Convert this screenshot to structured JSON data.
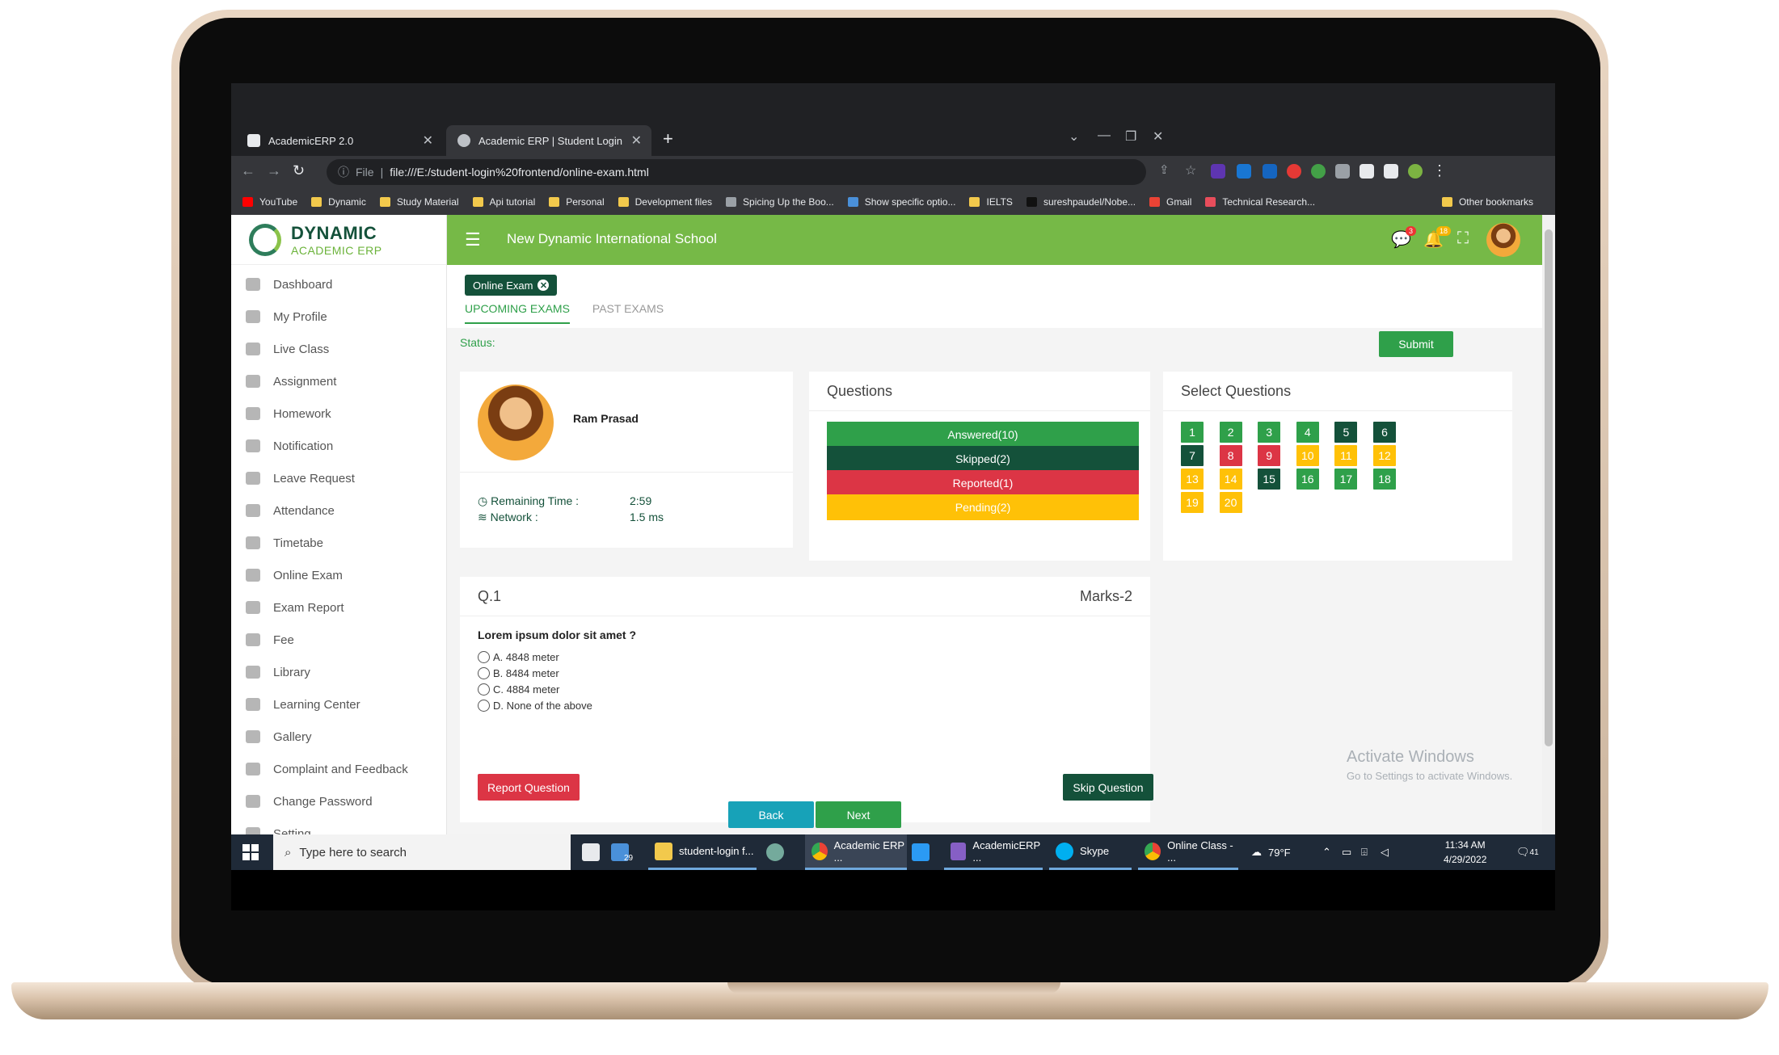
{
  "browser": {
    "tabs": [
      {
        "label": "AcademicERP 2.0"
      },
      {
        "label": "Academic ERP | Student Login"
      }
    ],
    "url_prefix": "File",
    "url": "file:///E:/student-login%20frontend/online-exam.html",
    "bookmarks": [
      {
        "label": "YouTube",
        "color": "#ff0000"
      },
      {
        "label": "Dynamic",
        "color": "#f2c94c"
      },
      {
        "label": "Study Material",
        "color": "#f2c94c"
      },
      {
        "label": "Api tutorial",
        "color": "#f2c94c"
      },
      {
        "label": "Personal",
        "color": "#f2c94c"
      },
      {
        "label": "Development files",
        "color": "#f2c94c"
      },
      {
        "label": "Spicing Up the Boo...",
        "color": "#9aa0a6"
      },
      {
        "label": "Show specific optio...",
        "color": "#4a90d9"
      },
      {
        "label": "IELTS",
        "color": "#f2c94c"
      },
      {
        "label": "sureshpaudel/Nobe...",
        "color": "#111111"
      },
      {
        "label": "Gmail",
        "color": "#ea4335"
      },
      {
        "label": "Technical Research...",
        "color": "#e84d5b"
      }
    ],
    "other_bookmarks": "Other bookmarks"
  },
  "app": {
    "logo_title": "DYNAMIC",
    "logo_sub": "ACADEMIC ERP",
    "school": "New Dynamic International School",
    "notif_badge_1": "3",
    "notif_badge_2": "18",
    "menu": [
      "Dashboard",
      "My Profile",
      "Live Class",
      "Assignment",
      "Homework",
      "Notification",
      "Leave Request",
      "Attendance",
      "Timetabe",
      "Online Exam",
      "Exam Report",
      "Fee",
      "Library",
      "Learning Center",
      "Gallery",
      "Complaint and Feedback",
      "Change Password",
      "Setting"
    ],
    "chip": "Online Exam",
    "tabs": [
      "UPCOMING EXAMS",
      "PAST EXAMS"
    ],
    "status_label": "Status:",
    "submit_label": "Submit"
  },
  "profile": {
    "name": "Ram Prasad",
    "remaining_label": "Remaining Time :",
    "remaining_value": "2:59",
    "network_label": "Network :",
    "network_value": "1.5 ms"
  },
  "questions_card": {
    "title": "Questions",
    "answered": "Answered(10)",
    "skipped": "Skipped(2)",
    "reported": "Reported(1)",
    "pending": "Pending(2)"
  },
  "select_card": {
    "title": "Select Questions",
    "numbers": [
      {
        "n": "1",
        "state": "answered"
      },
      {
        "n": "2",
        "state": "answered"
      },
      {
        "n": "3",
        "state": "answered"
      },
      {
        "n": "4",
        "state": "answered"
      },
      {
        "n": "5",
        "state": "skipped"
      },
      {
        "n": "6",
        "state": "skipped"
      },
      {
        "n": "7",
        "state": "skipped"
      },
      {
        "n": "8",
        "state": "reported"
      },
      {
        "n": "9",
        "state": "reported"
      },
      {
        "n": "10",
        "state": "pending"
      },
      {
        "n": "11",
        "state": "pending"
      },
      {
        "n": "12",
        "state": "pending"
      },
      {
        "n": "13",
        "state": "pending"
      },
      {
        "n": "14",
        "state": "pending"
      },
      {
        "n": "15",
        "state": "skipped"
      },
      {
        "n": "16",
        "state": "answered"
      },
      {
        "n": "17",
        "state": "answered"
      },
      {
        "n": "18",
        "state": "answered"
      },
      {
        "n": "19",
        "state": "pending"
      },
      {
        "n": "20",
        "state": "pending"
      }
    ]
  },
  "question": {
    "number": "Q.1",
    "marks": "Marks-2",
    "text": "Lorem ipsum dolor sit amet ?",
    "options": [
      "A. 4848 meter",
      "B. 8484 meter",
      "C. 4884 meter",
      "D. None of the above"
    ],
    "report_label": "Report Question",
    "skip_label": "Skip Question",
    "back_label": "Back",
    "next_label": "Next"
  },
  "watermark": {
    "line1": "Activate Windows",
    "line2": "Go to Settings to activate Windows."
  },
  "taskbar": {
    "search_placeholder": "Type here to search",
    "mail_badge": "29",
    "items": [
      "student-login f...",
      "Academic ERP ...",
      "AcademicERP ...",
      "Skype",
      "Online Class - ..."
    ],
    "temperature": "79°F",
    "time": "11:34 AM",
    "date": "4/29/2022",
    "notif_count": "41"
  },
  "colors": {
    "primary_green": "#76b947",
    "answered": "#2fa04a",
    "skipped": "#14513a",
    "reported": "#dc3545",
    "pending": "#ffc107"
  }
}
